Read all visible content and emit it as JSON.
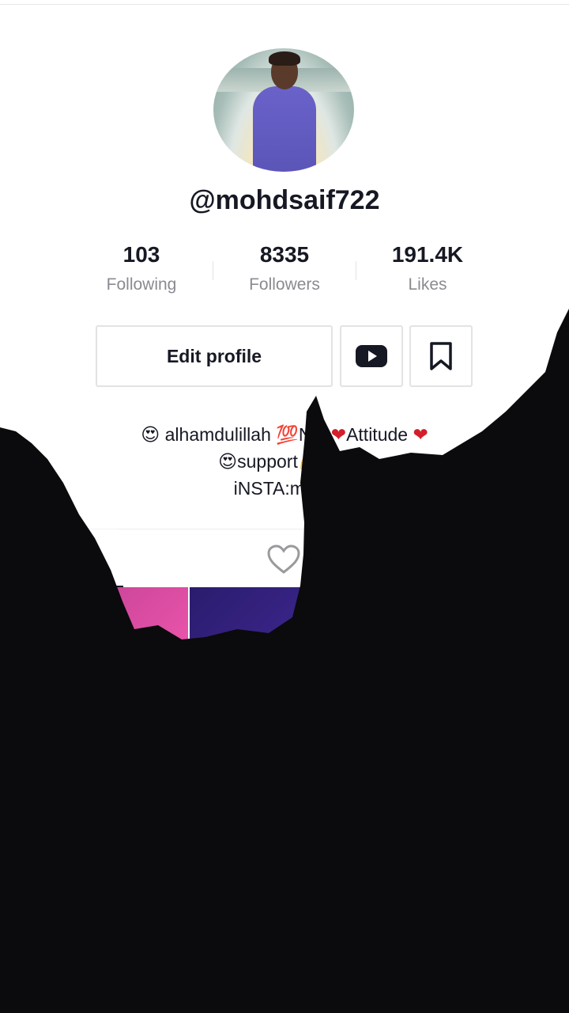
{
  "profile": {
    "username": "@mohdsaif722",
    "avatar_icon": "profile-photo"
  },
  "stats": [
    {
      "value": "103",
      "label": "Following"
    },
    {
      "value": "8335",
      "label": "Followers"
    },
    {
      "value": "191.4K",
      "label": "Likes"
    }
  ],
  "actions": {
    "edit_profile_label": "Edit profile",
    "youtube_icon": "youtube-icon",
    "bookmark_icon": "bookmark-icon"
  },
  "bio": {
    "line1_emoji": "😍",
    "line1_text": " alhamdulillah 💯NO ",
    "line1_heart": "❤",
    "line1_text2": "Attitude ",
    "line1_heart2": "❤",
    "line2": "😍support💪 me",
    "line3": "iNSTA:mohd"
  },
  "tabs": {
    "videos_icon": "⦀",
    "liked_icon": "heart-outline-icon"
  },
  "colors": {
    "text": "#161823",
    "secondary": "#8a8b91",
    "border": "#e3e3e4",
    "heart": "#d41f2b"
  }
}
